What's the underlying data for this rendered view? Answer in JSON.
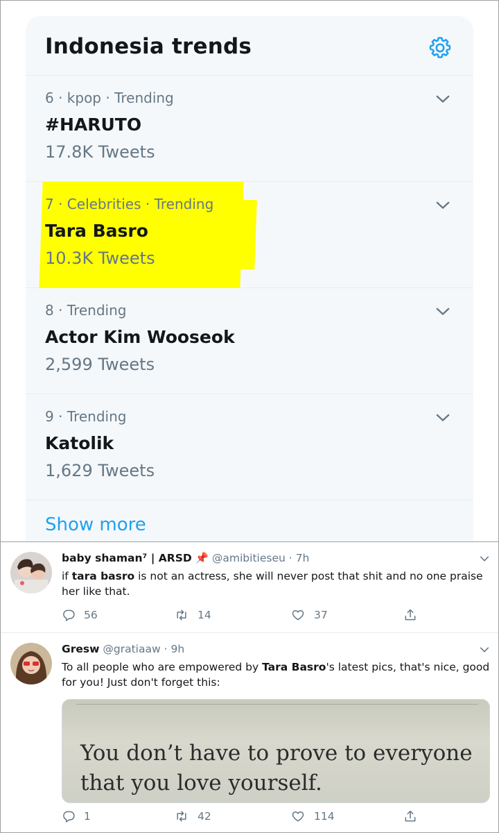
{
  "trends": {
    "title": "Indonesia trends",
    "items": [
      {
        "meta": "6 · kpop · Trending",
        "name": "#HARUTO",
        "count": "17.8K Tweets",
        "highlighted": false
      },
      {
        "meta": "7 · Celebrities · Trending",
        "name": "Tara Basro",
        "count": "10.3K Tweets",
        "highlighted": true
      },
      {
        "meta": "8 · Trending",
        "name": "Actor Kim Wooseok",
        "count": "2,599 Tweets",
        "highlighted": false
      },
      {
        "meta": "9 · Trending",
        "name": "Katolik",
        "count": "1,629 Tweets",
        "highlighted": false
      }
    ],
    "show_more": "Show more",
    "accent_color": "#1da1f2",
    "highlight_color": "#ffff00"
  },
  "tweets": [
    {
      "name": "baby shaman⁷ | ARSD",
      "handle": "@amibitieseu",
      "dot": "·",
      "time": "7h",
      "text_parts": [
        "if ",
        "tara basro",
        " is not an actress, she will never post that shit and no one praise her like that."
      ],
      "replies": "56",
      "retweets": "14",
      "likes": "37"
    },
    {
      "name": "Gresw",
      "handle": "@gratiaaw",
      "dot": "·",
      "time": "9h",
      "text_parts": [
        "To all people who are empowered by ",
        "Tara Basro",
        "'s latest pics, that's nice, good for you! Just don't forget this:"
      ],
      "media_text": [
        "You don’t have to prove to everyone",
        "that you love yourself."
      ],
      "replies": "1",
      "retweets": "42",
      "likes": "114"
    }
  ],
  "icons": {
    "settings": "gear-icon",
    "chevron": "chevron-down-icon",
    "pin": "pushpin-emoji",
    "reply": "reply-icon",
    "retweet": "retweet-icon",
    "like": "heart-icon",
    "share": "share-icon"
  }
}
